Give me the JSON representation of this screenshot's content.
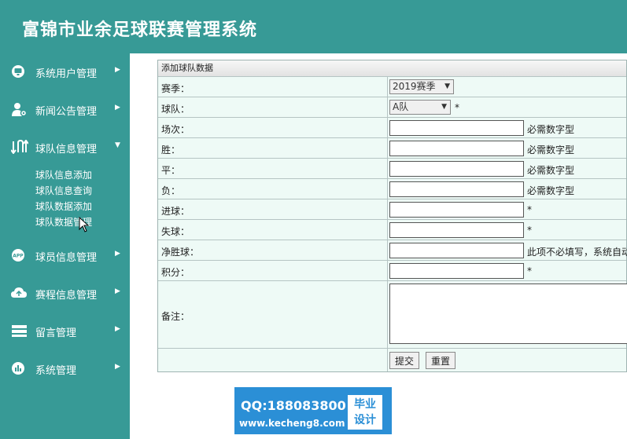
{
  "app": {
    "title": "富锦市业余足球联赛管理系统"
  },
  "sidebar": {
    "menus": [
      {
        "label": "系统用户管理",
        "icon": "monitor-icon"
      },
      {
        "label": "新闻公告管理",
        "icon": "user-gear-icon"
      },
      {
        "label": "球队信息管理",
        "icon": "swap-icon",
        "expanded": true
      },
      {
        "label": "球员信息管理",
        "icon": "app-icon"
      },
      {
        "label": "赛程信息管理",
        "icon": "cloud-icon"
      },
      {
        "label": "留言管理",
        "icon": "layers-icon"
      },
      {
        "label": "系统管理",
        "icon": "bar-chart-icon"
      }
    ],
    "submenu": [
      "球队信息添加",
      "球队信息查询",
      "球队数据添加",
      "球队数据管理"
    ]
  },
  "form": {
    "heading": "添加球队数据",
    "season": {
      "label": "赛季：",
      "selected": "2019赛季"
    },
    "team": {
      "label": "球队：",
      "selected": "A队",
      "required": "*"
    },
    "match_count": {
      "label": "场次：",
      "hint": "必需数字型"
    },
    "wins": {
      "label": "胜：",
      "hint": "必需数字型"
    },
    "draws": {
      "label": "平：",
      "hint": "必需数字型"
    },
    "losses": {
      "label": "负：",
      "hint": "必需数字型"
    },
    "goals_for": {
      "label": "进球：",
      "hint": "*"
    },
    "goals_against": {
      "label": "失球：",
      "hint": "*"
    },
    "goal_diff": {
      "label": "净胜球：",
      "hint": "此项不必填写，系统自动"
    },
    "points": {
      "label": "积分：",
      "hint": "*"
    },
    "remarks": {
      "label": "备注："
    },
    "submit_label": "提交",
    "reset_label": "重置"
  },
  "watermark": {
    "qq": "QQ:188083800",
    "site": "www.kecheng8.com",
    "badge_line1": "毕业",
    "badge_line2": "设计"
  },
  "colors": {
    "sidebar": "#379a96",
    "form_bg": "#eefaf6",
    "watermark": "#2b8fd6"
  }
}
